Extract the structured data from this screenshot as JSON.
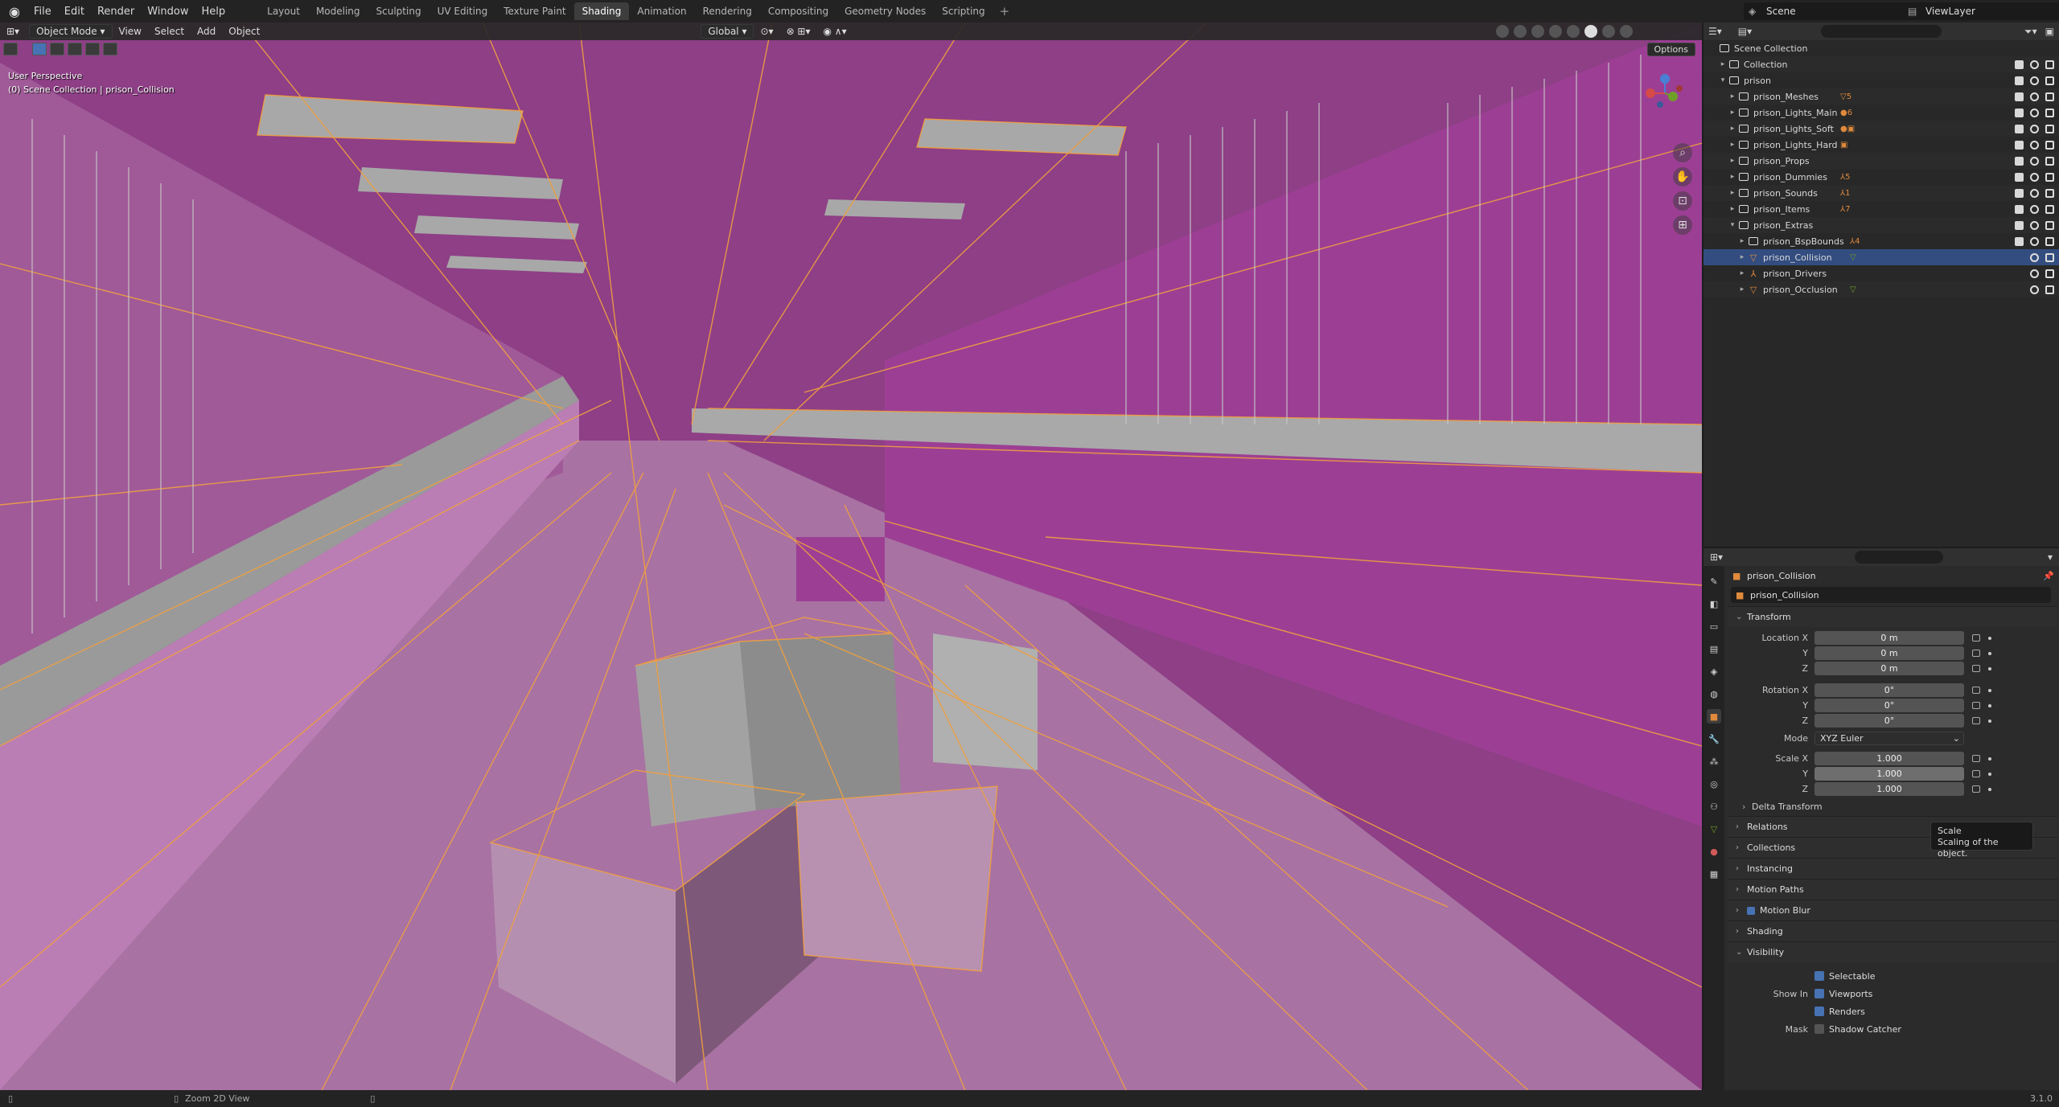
{
  "app": {
    "menus": [
      "File",
      "Edit",
      "Render",
      "Window",
      "Help"
    ],
    "workspaces": [
      "Layout",
      "Modeling",
      "Sculpting",
      "UV Editing",
      "Texture Paint",
      "Shading",
      "Animation",
      "Rendering",
      "Compositing",
      "Geometry Nodes",
      "Scripting"
    ],
    "active_workspace": "Shading",
    "scene": "Scene",
    "view_layer": "ViewLayer",
    "add_tab": "+"
  },
  "viewport": {
    "mode": "Object Mode",
    "menus": [
      "View",
      "Select",
      "Add",
      "Object"
    ],
    "transform_orientation": "Global",
    "options": "Options",
    "view_name": "User Perspective",
    "collection_path": "(0) Scene Collection | prison_Collision",
    "colors": {
      "bg": "#8a3c82",
      "wire": "#f0a040",
      "surface": "#b687b0",
      "gray": "#9a9a9a"
    }
  },
  "outliner": {
    "rows": [
      {
        "label": "Scene Collection",
        "indent": 0,
        "icon": "collection"
      },
      {
        "label": "Collection",
        "indent": 1,
        "icon": "collection"
      },
      {
        "label": "prison",
        "indent": 1,
        "icon": "collection",
        "expanded": true
      },
      {
        "label": "prison_Meshes",
        "indent": 2,
        "icon": "collection",
        "badge": "▽5"
      },
      {
        "label": "prison_Lights_Main",
        "indent": 2,
        "icon": "collection",
        "badge": "●6"
      },
      {
        "label": "prison_Lights_Soft",
        "indent": 2,
        "icon": "collection",
        "badge": "●▣"
      },
      {
        "label": "prison_Lights_Hard",
        "indent": 2,
        "icon": "collection",
        "badge": "▣"
      },
      {
        "label": "prison_Props",
        "indent": 2,
        "icon": "collection",
        "badge": ""
      },
      {
        "label": "prison_Dummies",
        "indent": 2,
        "icon": "collection",
        "badge": "⅄5"
      },
      {
        "label": "prison_Sounds",
        "indent": 2,
        "icon": "collection",
        "badge": "⅄1"
      },
      {
        "label": "prison_Items",
        "indent": 2,
        "icon": "collection",
        "badge": "⅄7"
      },
      {
        "label": "prison_Extras",
        "indent": 2,
        "icon": "collection",
        "expanded": true,
        "badge": ""
      },
      {
        "label": "prison_BspBounds",
        "indent": 3,
        "icon": "collection",
        "badge": "⅄4"
      },
      {
        "label": "prison_Collision",
        "indent": 3,
        "icon": "mesh",
        "badge": "▽",
        "selected": true
      },
      {
        "label": "prison_Drivers",
        "indent": 3,
        "icon": "empty",
        "badge": ""
      },
      {
        "label": "prison_Occlusion",
        "indent": 3,
        "icon": "mesh",
        "badge": "▽"
      }
    ]
  },
  "properties": {
    "object_name": "prison_Collision",
    "object_field": "prison_Collision",
    "transform": {
      "title": "Transform",
      "location": {
        "label": "Location X",
        "x": "0 m",
        "y": "0 m",
        "z": "0 m"
      },
      "rotation": {
        "label": "Rotation X",
        "x": "0°",
        "y": "0°",
        "z": "0°"
      },
      "mode_label": "Mode",
      "mode": "XYZ Euler",
      "scale": {
        "label": "Scale X",
        "x": "1.000",
        "y": "1.000",
        "z": "1.000"
      },
      "y_label": "Y",
      "z_label": "Z"
    },
    "delta_transform": "Delta Transform",
    "panels": [
      "Relations",
      "Collections",
      "Instancing",
      "Motion Paths",
      "Motion Blur",
      "Shading"
    ],
    "visibility": {
      "title": "Visibility",
      "selectable": "Selectable",
      "show_in_label": "Show In",
      "viewports": "Viewports",
      "renders": "Renders",
      "mask_label": "Mask",
      "shadow_catcher": "Shadow Catcher"
    },
    "tooltip": {
      "title": "Scale",
      "desc": "Scaling of the object."
    }
  },
  "status": {
    "hint": "Zoom 2D View",
    "version": "3.1.0"
  }
}
